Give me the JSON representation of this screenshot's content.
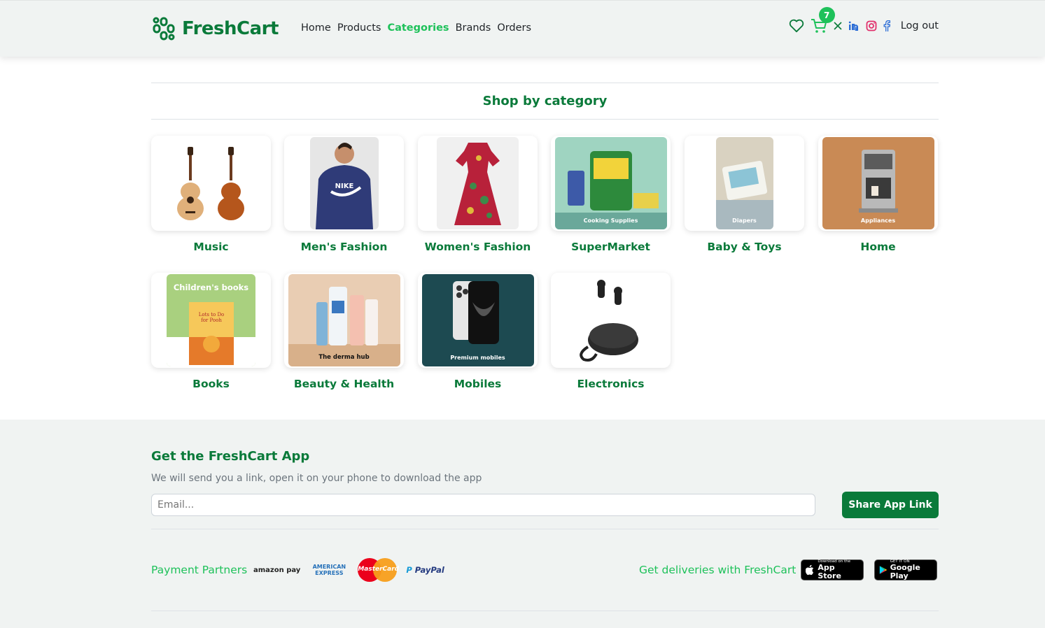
{
  "brand": {
    "name": "FreshCart"
  },
  "nav": {
    "links": [
      "Home",
      "Products",
      "Categories",
      "Brands",
      "Orders"
    ],
    "active": "Categories",
    "cart_count": "7",
    "logout_label": "Log out",
    "icons": [
      "heart-icon",
      "cart-icon",
      "x-twitter-icon",
      "linkedin-icon",
      "instagram-icon",
      "facebook-icon"
    ]
  },
  "categories": {
    "heading": "Shop by category",
    "items": [
      {
        "label": "Music",
        "image_caption": ""
      },
      {
        "label": "Men's Fashion",
        "image_caption": ""
      },
      {
        "label": "Women's Fashion",
        "image_caption": ""
      },
      {
        "label": "SuperMarket",
        "image_caption": "Cooking Supplies"
      },
      {
        "label": "Baby & Toys",
        "image_caption": "Diapers"
      },
      {
        "label": "Home",
        "image_caption": "Appliances"
      },
      {
        "label": "Books",
        "image_caption": "Children's books"
      },
      {
        "label": "Beauty & Health",
        "image_caption": "The derma hub"
      },
      {
        "label": "Mobiles",
        "image_caption": "Premium mobiles"
      },
      {
        "label": "Electronics",
        "image_caption": ""
      }
    ]
  },
  "footer": {
    "title": "Get the FreshCart App",
    "subtitle": "We will send you a link, open it on your phone to download the app",
    "email_placeholder": "Email...",
    "share_label": "Share App Link",
    "payment_label": "Payment Partners",
    "payment_partners": [
      "amazon pay",
      "AMERICAN EXPRESS",
      "MasterCard",
      "PayPal"
    ],
    "delivery_label": "Get deliveries with FreshCart",
    "app_store": {
      "small": "Download on the",
      "big": "App Store"
    },
    "google_play": {
      "small": "GET IT ON",
      "big": "Google Play"
    }
  },
  "colors": {
    "primary": "#0a7a3a",
    "accent": "#1ec15a",
    "navbar_bg": "#f0f3f2"
  }
}
